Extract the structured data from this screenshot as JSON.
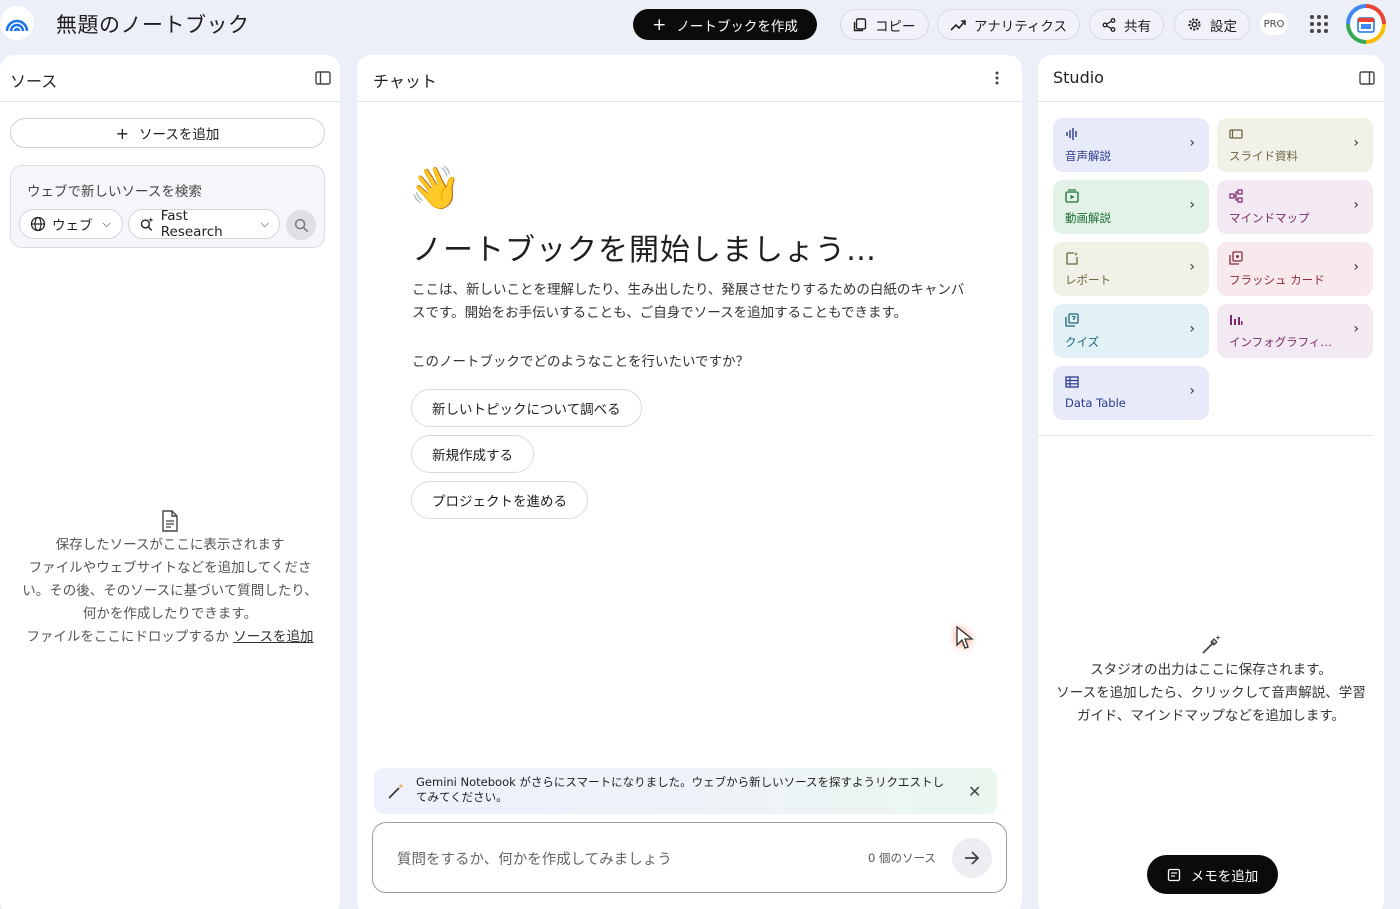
{
  "app": {
    "title": "無題のノートブック",
    "create_label": "ノートブックを作成",
    "copy_label": "コピー",
    "analytics_label": "アナリティクス",
    "share_label": "共有",
    "settings_label": "設定",
    "pro_badge": "PRO"
  },
  "sources": {
    "title": "ソース",
    "add_label": "ソースを追加",
    "search_placeholder": "ウェブで新しいソースを検索",
    "web_label": "ウェブ",
    "research_label": "Fast Research",
    "empty_line1": "保存したソースがここに表示されます",
    "empty_line2": "ファイルやウェブサイトなどを追加してくださ",
    "empty_line3": "い。その後、そのソースに基づいて質問したり、",
    "empty_line4": "何かを作成したりできます。",
    "empty_line5_prefix": "ファイルをここにドロップするか ",
    "empty_link": "ソースを追加"
  },
  "chat": {
    "title": "チャット",
    "heading": "ノートブックを開始しましょう…",
    "desc_line1": "ここは、新しいことを理解したり、生み出したり、発展させたりするための白紙のキャンバ",
    "desc_line2": "スです。開始をお手伝いすることも、ご自身でソースを追加することもできます。",
    "question": "このノートブックでどのようなことを行いたいですか？",
    "suggestions": [
      "新しいトピックについて調べる",
      "新規作成する",
      "プロジェクトを進める"
    ],
    "banner_line1": "Gemini Notebook がさらにスマートになりました。ウェブから新しいソースを探すようリクエストし",
    "banner_line2": "てみてください。",
    "input_placeholder": "質問をするか、何かを作成してみましょう",
    "source_count": "0 個のソース"
  },
  "studio": {
    "title": "Studio",
    "cards": [
      {
        "label": "音声解説",
        "bg": "#e7eaf8",
        "fg": "#2b3a8f"
      },
      {
        "label": "スライド資料",
        "bg": "#f1f1e8",
        "fg": "#6b6640"
      },
      {
        "label": "動画解説",
        "bg": "#e2f2e6",
        "fg": "#1d6b36"
      },
      {
        "label": "マインドマップ",
        "bg": "#f3e9f2",
        "fg": "#7a2a6b"
      },
      {
        "label": "レポート",
        "bg": "#f1f1e8",
        "fg": "#6b6640"
      },
      {
        "label": "フラッシュ カード",
        "bg": "#f7e9ec",
        "fg": "#8a2a3c"
      },
      {
        "label": "クイズ",
        "bg": "#e1f1f6",
        "fg": "#1c6478"
      },
      {
        "label": "インフォグラフィ…",
        "bg": "#f3e9f2",
        "fg": "#7a2a6b"
      },
      {
        "label": "Data Table",
        "bg": "#e7eaf8",
        "fg": "#2b3a8f"
      }
    ],
    "empty_line1": "スタジオの出力はここに保存されます。",
    "empty_line2": "ソースを追加したら、クリックして音声解説、学習",
    "empty_line3": "ガイド、マインドマップなどを追加します。",
    "memo_label": "メモを追加"
  }
}
